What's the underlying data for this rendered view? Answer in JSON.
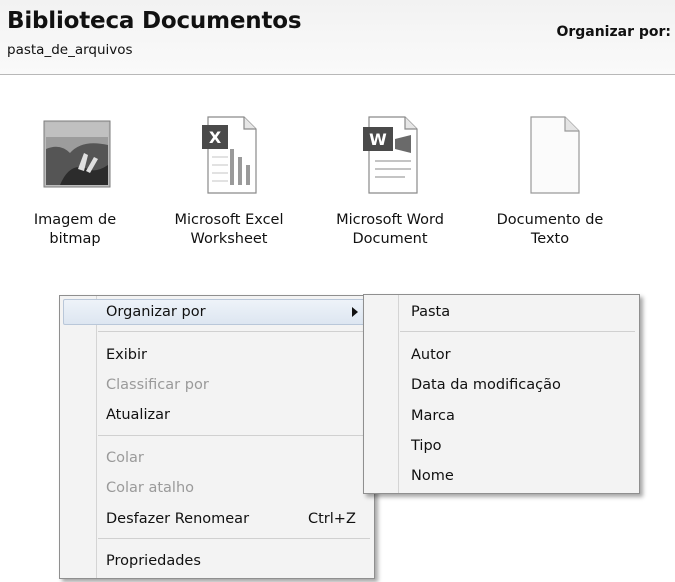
{
  "header": {
    "title": "Biblioteca Documentos",
    "subtitle": "pasta_de_arquivos",
    "arrange_by": "Organizar por:"
  },
  "files": [
    {
      "label_line1": "Imagem de",
      "label_line2": "bitmap",
      "icon": "bitmap-image-icon"
    },
    {
      "label_line1": "Microsoft Excel",
      "label_line2": "Worksheet",
      "icon": "excel-document-icon"
    },
    {
      "label_line1": "Microsoft Word",
      "label_line2": "Document",
      "icon": "word-document-icon"
    },
    {
      "label_line1": "Documento de",
      "label_line2": "Texto",
      "icon": "text-document-icon"
    }
  ],
  "context_menu": {
    "items": [
      {
        "label": "Organizar por",
        "has_submenu": true,
        "highlighted": true
      },
      {
        "label": "Exibir"
      },
      {
        "label": "Classificar por",
        "disabled": true
      },
      {
        "label": "Atualizar"
      },
      {
        "label": "Colar",
        "disabled": true
      },
      {
        "label": "Colar atalho",
        "disabled": true
      },
      {
        "label": "Desfazer Renomear",
        "shortcut": "Ctrl+Z"
      },
      {
        "label": "Propriedades"
      }
    ]
  },
  "submenu": {
    "items": [
      {
        "label": "Pasta"
      },
      {
        "label": "Autor"
      },
      {
        "label": "Data da modificação"
      },
      {
        "label": "Marca"
      },
      {
        "label": "Tipo"
      },
      {
        "label": "Nome"
      }
    ]
  }
}
